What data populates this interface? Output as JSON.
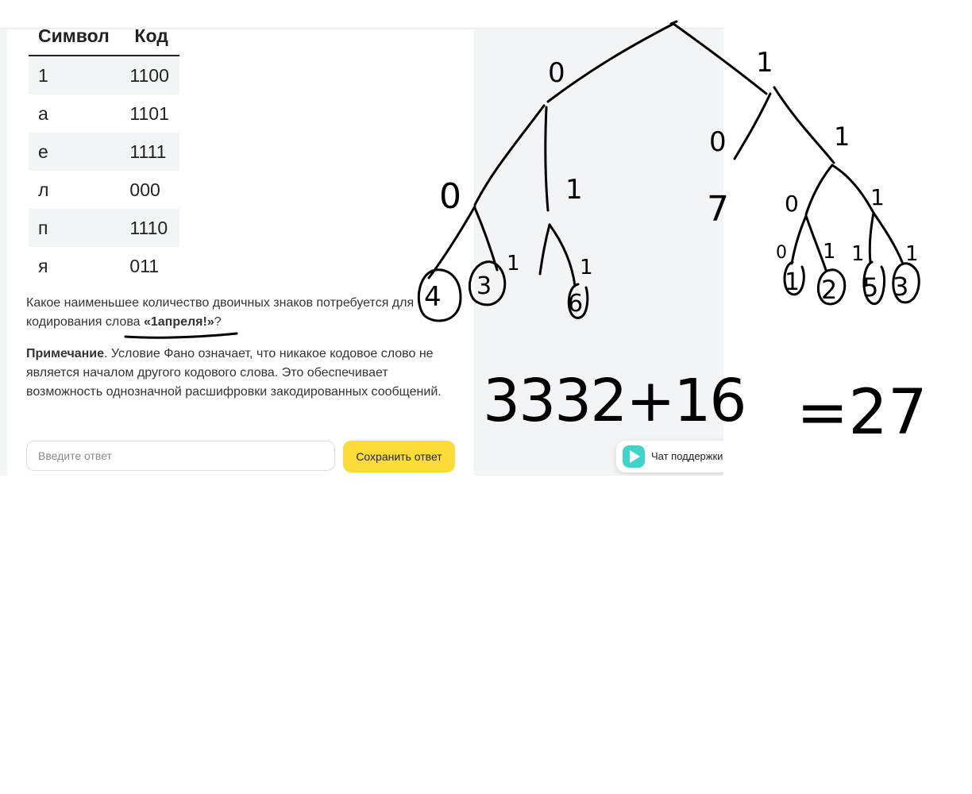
{
  "table": {
    "headers": [
      "Символ",
      "Код"
    ],
    "rows": [
      {
        "symbol": "1",
        "code": "1100"
      },
      {
        "symbol": "а",
        "code": "1101"
      },
      {
        "symbol": "е",
        "code": "1111"
      },
      {
        "symbol": "л",
        "code": "000"
      },
      {
        "symbol": "п",
        "code": "1110"
      },
      {
        "symbol": "я",
        "code": "011"
      }
    ]
  },
  "question": {
    "text_before": "Какое наименьшее количество двоичных знаков потребуется для кодирования слова ",
    "word": "«1апреля!»",
    "text_after": "?"
  },
  "note": {
    "label": "Примечание",
    "text": ". Условие Фано означает, что никакое кодовое слово не является началом другого кодового слова. Это обеспечивает возможность однозначной расшифровки закодированных сообщений."
  },
  "answer": {
    "placeholder": "Введите ответ",
    "value": ""
  },
  "save_button": {
    "label": "Сохранить ответ"
  },
  "chat": {
    "label": "Чат поддержки"
  },
  "handwriting": {
    "edge_labels": [
      "0",
      "1",
      "0",
      "1",
      "0",
      "1",
      "0",
      "1",
      "1",
      "1",
      "0",
      "1",
      "1",
      "1"
    ],
    "leaf_numbers": [
      "4",
      "3",
      "6",
      "1",
      "2",
      "5",
      "3",
      "7"
    ],
    "calculation_left": "3332+16",
    "calculation_right": "=27"
  },
  "colors": {
    "accent_button": "#fddc3a",
    "panel_gray": "#f3f4f6",
    "ink": "#000000"
  }
}
